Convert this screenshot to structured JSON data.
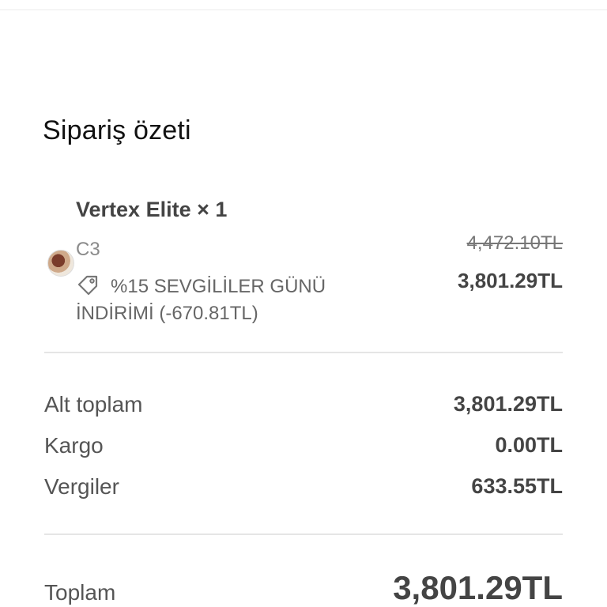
{
  "order_summary": {
    "title": "Sipariş özeti",
    "product": {
      "name": "Vertex Elite × 1",
      "variant": "C3",
      "discount_label": "%15 SEVGİLİLER GÜNÜ İNDİRİMİ (-670.81TL)",
      "original_price": "4,472.10TL",
      "price": "3,801.29TL",
      "icons": {
        "thumbnail": "product-thumbnail",
        "discount": "tag-icon"
      }
    },
    "rows": [
      {
        "label": "Alt toplam",
        "value": "3,801.29TL"
      },
      {
        "label": "Kargo",
        "value": "0.00TL"
      },
      {
        "label": "Vergiler",
        "value": "633.55TL"
      }
    ],
    "total": {
      "label": "Toplam",
      "value": "3,801.29TL"
    }
  }
}
